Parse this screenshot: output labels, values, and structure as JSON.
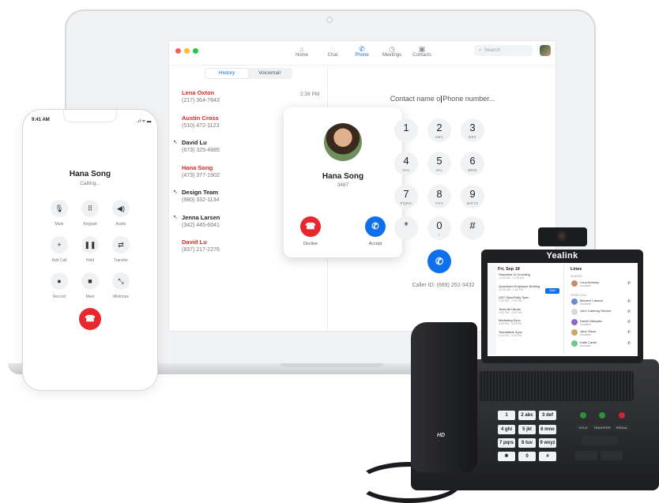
{
  "laptop_app": {
    "nav": [
      {
        "label": "Home",
        "icon": "home-icon",
        "glyph": "⌂"
      },
      {
        "label": "Chat",
        "icon": "chat-icon",
        "glyph": "◌"
      },
      {
        "label": "Phone",
        "icon": "phone-icon",
        "glyph": "✆"
      },
      {
        "label": "Meetings",
        "icon": "clock-icon",
        "glyph": "◷"
      },
      {
        "label": "Contacts",
        "icon": "contacts-icon",
        "glyph": "▣"
      }
    ],
    "search_placeholder": "Search",
    "tabs": [
      "History",
      "Voicemail"
    ],
    "history": [
      {
        "name": "Lena Oxton",
        "number": "(217) 364-7843",
        "missed": true,
        "time": "2:39 PM"
      },
      {
        "name": "Austin Cross",
        "number": "(510) 472-1123",
        "missed": true
      },
      {
        "name": "David Lu",
        "number": "(673) 325-4885",
        "missed": false
      },
      {
        "name": "Hana Song",
        "number": "(473) 377-1902",
        "missed": true
      },
      {
        "name": "Design Team",
        "number": "(980) 332-1134",
        "missed": false
      },
      {
        "name": "Jenna Larsen",
        "number": "(342) 445-6041",
        "missed": false
      },
      {
        "name": "David Lu",
        "number": "(837) 217-2276",
        "missed": true
      }
    ],
    "incoming": {
      "name": "Hana Song",
      "ext": "3487",
      "decline_label": "Decline",
      "accept_label": "Accept"
    },
    "dial_placeholder_left": "Contact name o",
    "dial_placeholder_right": "Phone number...",
    "keys": [
      {
        "d": "1",
        "l": ""
      },
      {
        "d": "2",
        "l": "ABC"
      },
      {
        "d": "3",
        "l": "DEF"
      },
      {
        "d": "4",
        "l": "GHI"
      },
      {
        "d": "5",
        "l": "JKL"
      },
      {
        "d": "6",
        "l": "MNO"
      },
      {
        "d": "7",
        "l": "PQRS"
      },
      {
        "d": "8",
        "l": "TUV"
      },
      {
        "d": "9",
        "l": "WXYZ"
      },
      {
        "d": "*",
        "l": ""
      },
      {
        "d": "0",
        "l": "+"
      },
      {
        "d": "#",
        "l": ""
      }
    ],
    "caller_id": "Caller ID: (669) 252-3432"
  },
  "mobile": {
    "time": "9:41 AM",
    "status_icons": "..ıl ᯤ ▬",
    "name": "Hana Song",
    "status": "Calling...",
    "buttons": [
      {
        "label": "Mute",
        "icon": "mic-icon",
        "glyph": "🎙"
      },
      {
        "label": "Keypad",
        "icon": "keypad-icon",
        "glyph": "⠿"
      },
      {
        "label": "Audio",
        "icon": "speaker-icon",
        "glyph": "◀)"
      },
      {
        "label": "Add Call",
        "icon": "plus-icon",
        "glyph": "+"
      },
      {
        "label": "Hold",
        "icon": "pause-icon",
        "glyph": "❚❚"
      },
      {
        "label": "Transfer",
        "icon": "transfer-icon",
        "glyph": "⇄"
      },
      {
        "label": "Record",
        "icon": "record-icon",
        "glyph": "●"
      },
      {
        "label": "Meet",
        "icon": "video-icon",
        "glyph": "■"
      },
      {
        "label": "Minimize",
        "icon": "minimize-icon",
        "glyph": "⤡"
      }
    ]
  },
  "desk_phone": {
    "brand": "Yealink",
    "hd_mark": "HD",
    "screen": {
      "date": "Fri, Sep 18",
      "lines_title": "Lines",
      "events": [
        {
          "title": "Standstar UI Unveiling",
          "sub": "10:00 AM - 11:30 AM"
        },
        {
          "title": "Quantoom Employee Briefing",
          "sub": "12:00 AM - 1:00 PM"
        },
        {
          "title": "Q3C Sync/Daily Sync",
          "sub": "1:00 PM - 2:00 PM"
        },
        {
          "title": "Team All Hands",
          "sub": "3:00 PM - 4:00 PM"
        },
        {
          "title": "Marketing Sync",
          "sub": "4:00 PM - 5:00 PM"
        },
        {
          "title": "TeamMade Sync",
          "sub": "5:00 PM - 6:00 PM"
        }
      ],
      "start_label": "Start",
      "shared_label": "SHARED",
      "speed_label": "SPEED DIAL",
      "lines": [
        {
          "name": "Cora Anthony",
          "sub": "Available"
        },
        {
          "name": "Maurice Lawson",
          "sub": "Available"
        },
        {
          "name": "John Catering Service",
          "sub": ""
        },
        {
          "name": "Daniel Marquez",
          "sub": "Available"
        },
        {
          "name": "Jane Olson",
          "sub": "Available"
        },
        {
          "name": "Katie Carter",
          "sub": "Available"
        }
      ]
    },
    "keypad": [
      {
        "d": "1"
      },
      {
        "d": "2 abc"
      },
      {
        "d": "3 def"
      },
      {
        "d": "4 ghi"
      },
      {
        "d": "5 jkl"
      },
      {
        "d": "6 mno"
      },
      {
        "d": "7 pqrs"
      },
      {
        "d": "8 tuv"
      },
      {
        "d": "9 wxyz"
      },
      {
        "d": "✱"
      },
      {
        "d": "0"
      },
      {
        "d": "#"
      }
    ],
    "function_keys": [
      "HOLD",
      "TRANSFER",
      "REDIAL"
    ]
  }
}
